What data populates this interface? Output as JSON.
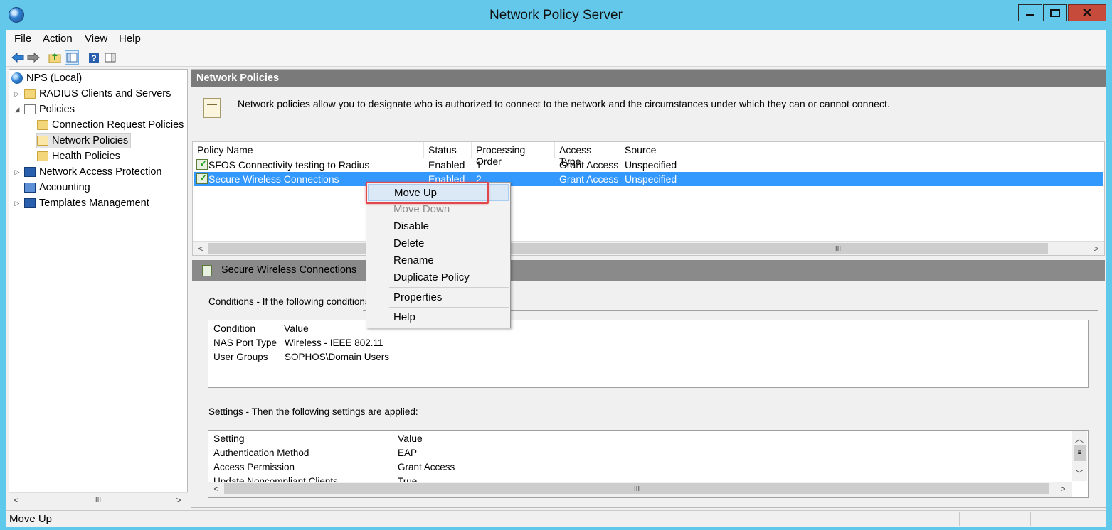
{
  "window": {
    "title": "Network Policy Server"
  },
  "menubar": [
    "File",
    "Action",
    "View",
    "Help"
  ],
  "tree": {
    "items": [
      {
        "label": "NPS (Local)"
      },
      {
        "label": "RADIUS Clients and Servers"
      },
      {
        "label": "Policies"
      },
      {
        "label": "Connection Request Policies"
      },
      {
        "label": "Network Policies"
      },
      {
        "label": "Health Policies"
      },
      {
        "label": "Network Access Protection"
      },
      {
        "label": "Accounting"
      },
      {
        "label": "Templates Management"
      }
    ],
    "selected": "Network Policies"
  },
  "main": {
    "header": "Network Policies",
    "description": "Network policies allow you to designate who is authorized to connect to the network and the circumstances under which they can or cannot connect.",
    "columns": [
      "Policy Name",
      "Status",
      "Processing Order",
      "Access Type",
      "Source"
    ],
    "rows": [
      [
        "SFOS Connectivity testing to Radius",
        "Enabled",
        "1",
        "Grant Access",
        "Unspecified"
      ],
      [
        "Secure Wireless Connections",
        "Enabled",
        "2",
        "Grant Access",
        "Unspecified"
      ]
    ],
    "selected_row": 1
  },
  "detail": {
    "title": "Secure Wireless Connections",
    "conditions_label": "Conditions - If the following conditions",
    "conditions_columns": [
      "Condition",
      "Value"
    ],
    "conditions_rows": [
      [
        "NAS Port Type",
        "Wireless - IEEE 802.11"
      ],
      [
        "User Groups",
        "SOPHOS\\Domain Users"
      ]
    ],
    "settings_label": "Settings - Then the following settings are applied:",
    "settings_columns": [
      "Setting",
      "Value"
    ],
    "settings_rows": [
      [
        "Authentication Method",
        "EAP"
      ],
      [
        "Access Permission",
        "Grant Access"
      ],
      [
        "Update Noncompliant Clients",
        "True"
      ]
    ]
  },
  "context_menu": {
    "items": [
      "Move Up",
      "Move Down",
      "Disable",
      "Delete",
      "Rename",
      "Duplicate Policy",
      "Properties",
      "Help"
    ],
    "disabled": [
      "Move Down"
    ],
    "hovered": "Move Up"
  },
  "scroll": {
    "thumb_glyph": "III"
  },
  "status_bar": {
    "text": "Move Up"
  },
  "colors": {
    "titlebar": "#64c8ea",
    "selection": "#3399ff",
    "highlight_box": "#e0474c"
  }
}
